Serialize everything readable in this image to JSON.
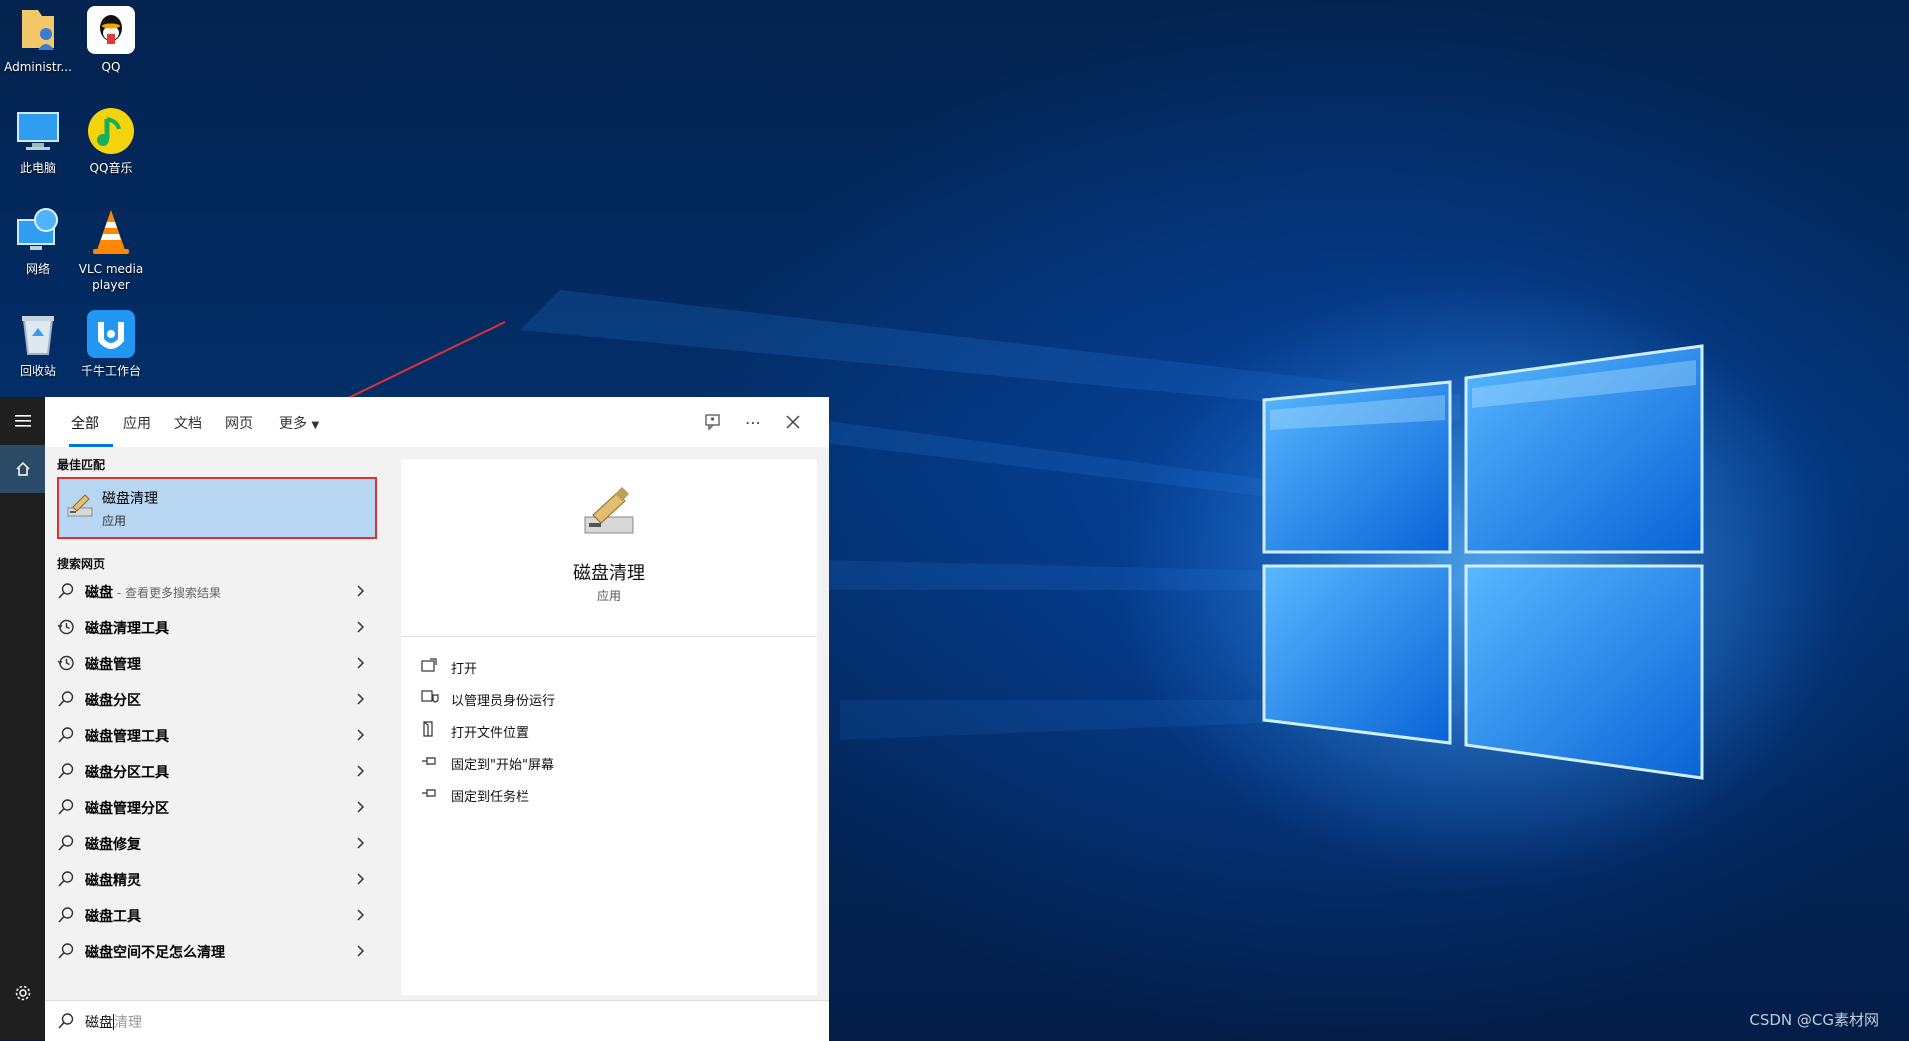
{
  "desktop": {
    "icons": [
      {
        "label": "Administr..."
      },
      {
        "label": "QQ"
      },
      {
        "label": "此电脑"
      },
      {
        "label": "QQ音乐"
      },
      {
        "label": "网络"
      },
      {
        "label": "VLC media player"
      },
      {
        "label": "回收站"
      },
      {
        "label": "千牛工作台"
      }
    ],
    "watermark": "CSDN @CG素材网"
  },
  "search": {
    "tabs": [
      {
        "label": "全部",
        "active": true
      },
      {
        "label": "应用"
      },
      {
        "label": "文档"
      },
      {
        "label": "网页"
      },
      {
        "label": "更多"
      }
    ],
    "best_match_title": "最佳匹配",
    "best_match": {
      "name": "磁盘清理",
      "type": "应用"
    },
    "web_title": "搜索网页",
    "web_results": [
      {
        "text": "磁盘",
        "hint": " - 查看更多搜索结果",
        "icon": "search-icon"
      },
      {
        "text": "磁盘清理工具",
        "icon": "history-icon"
      },
      {
        "text": "磁盘管理",
        "icon": "history-icon"
      },
      {
        "text": "磁盘分区",
        "icon": "search-icon"
      },
      {
        "text": "磁盘管理工具",
        "icon": "search-icon"
      },
      {
        "text": "磁盘分区工具",
        "icon": "search-icon"
      },
      {
        "text": "磁盘管理分区",
        "icon": "search-icon"
      },
      {
        "text": "磁盘修复",
        "icon": "search-icon"
      },
      {
        "text": "磁盘精灵",
        "icon": "search-icon"
      },
      {
        "text": "磁盘工具",
        "icon": "search-icon"
      },
      {
        "text": "磁盘空间不足怎么清理",
        "icon": "search-icon"
      }
    ],
    "detail": {
      "name": "磁盘清理",
      "type": "应用",
      "actions": [
        {
          "label": "打开",
          "icon": "open-icon"
        },
        {
          "label": "以管理员身份运行",
          "icon": "shield-icon"
        },
        {
          "label": "打开文件位置",
          "icon": "file-location-icon"
        },
        {
          "label": "固定到\"开始\"屏幕",
          "icon": "pin-icon"
        },
        {
          "label": "固定到任务栏",
          "icon": "pin-icon"
        }
      ]
    },
    "query_typed": "磁盘",
    "query_suggest": "清理"
  },
  "colors": {
    "accent": "#0078d7",
    "highlight": "#b6d6f2",
    "annotation_red": "#e03131"
  }
}
